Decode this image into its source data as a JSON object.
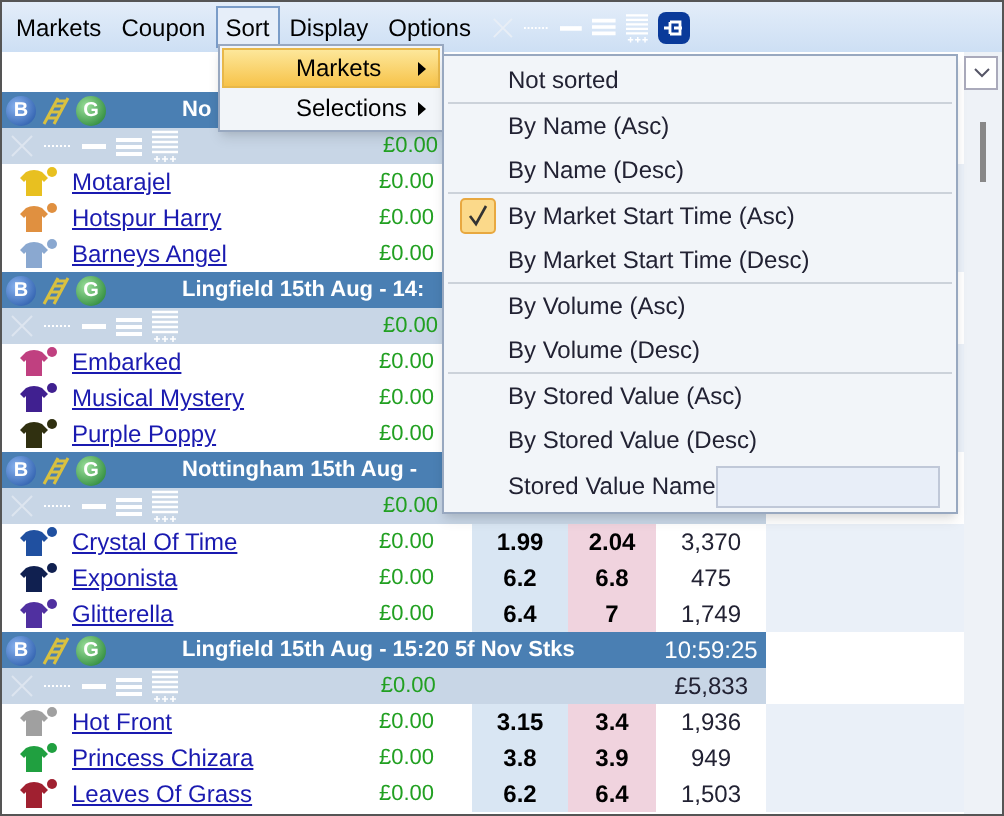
{
  "menubar": [
    {
      "label": "Markets",
      "selected": false
    },
    {
      "label": "Coupon",
      "selected": false
    },
    {
      "label": "Sort",
      "selected": true
    },
    {
      "label": "Display",
      "selected": false
    },
    {
      "label": "Options",
      "selected": false
    }
  ],
  "sort_menu": [
    {
      "label": "Markets",
      "selected": true
    },
    {
      "label": "Selections",
      "selected": false
    }
  ],
  "markets_submenu": [
    [
      {
        "kind": "item",
        "label": "Not sorted",
        "checked": false
      }
    ],
    [
      {
        "kind": "item",
        "label": "By Name (Asc)",
        "checked": false
      },
      {
        "kind": "item",
        "label": "By Name (Desc)",
        "checked": false
      }
    ],
    [
      {
        "kind": "item",
        "label": "By Market Start Time (Asc)",
        "checked": true
      },
      {
        "kind": "item",
        "label": "By Market Start Time (Desc)",
        "checked": false
      }
    ],
    [
      {
        "kind": "item",
        "label": "By Volume (Asc)",
        "checked": false
      },
      {
        "kind": "item",
        "label": "By Volume (Desc)",
        "checked": false
      }
    ],
    [
      {
        "kind": "item",
        "label": "By Stored Value (Asc)",
        "checked": false
      },
      {
        "kind": "item",
        "label": "By Stored Value (Desc)",
        "checked": false
      },
      {
        "kind": "field",
        "label": "Stored Value Name"
      }
    ]
  ],
  "markets": [
    {
      "badges": [
        "B",
        "G"
      ],
      "title": "No",
      "matched": "£0.00",
      "runners": [
        {
          "name": "Motarajel",
          "color": "#e8c020",
          "matched": "£0.00"
        },
        {
          "name": "Hotspur Harry",
          "color": "#e09040",
          "matched": "£0.00"
        },
        {
          "name": "Barneys Angel",
          "color": "#8aa8d0",
          "matched": "£0.00"
        }
      ]
    },
    {
      "badges": [
        "B",
        "G"
      ],
      "title": "Lingfield 15th Aug - 14:",
      "matched": "£0.00",
      "runners": [
        {
          "name": "Embarked",
          "color": "#c04080",
          "matched": "£0.00"
        },
        {
          "name": "Musical Mystery",
          "color": "#402090",
          "matched": "£0.00"
        },
        {
          "name": "Purple Poppy",
          "color": "#303010",
          "matched": "£0.00"
        }
      ]
    },
    {
      "badges": [
        "B",
        "G"
      ],
      "title": "Nottingham 15th Aug -",
      "matched": "£0.00",
      "runners": [
        {
          "name": "Crystal Of Time",
          "color": "#2050a0",
          "matched": "£0.00",
          "back": "1.99",
          "lay": "2.04",
          "volume": "3,370"
        },
        {
          "name": "Exponista",
          "color": "#102050",
          "matched": "£0.00",
          "back": "6.2",
          "lay": "6.8",
          "volume": "475"
        },
        {
          "name": "Glitterella",
          "color": "#5030a0",
          "matched": "£0.00",
          "back": "6.4",
          "lay": "7",
          "volume": "1,749"
        }
      ]
    },
    {
      "badges": [
        "B",
        "G"
      ],
      "title": "Lingfield 15th Aug - 15:20 5f Nov Stks",
      "time": "10:59:25",
      "matched": "£0.00",
      "total": "£5,833",
      "runners": [
        {
          "name": "Hot Front",
          "color": "#a0a0a0",
          "matched": "£0.00",
          "back": "3.15",
          "lay": "3.4",
          "volume": "1,936"
        },
        {
          "name": "Princess Chizara",
          "color": "#20a040",
          "matched": "£0.00",
          "back": "3.8",
          "lay": "3.9",
          "volume": "949"
        },
        {
          "name": "Leaves Of Grass",
          "color": "#a02030",
          "matched": "£0.00",
          "back": "6.2",
          "lay": "6.4",
          "volume": "1,503"
        }
      ]
    }
  ]
}
